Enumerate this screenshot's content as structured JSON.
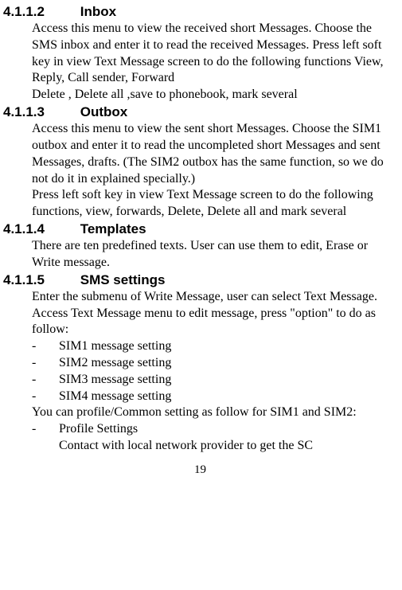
{
  "sections": {
    "inbox": {
      "num": "4.1.1.2",
      "title": "Inbox",
      "p1": "Access this menu to view the received short Messages. Choose the SMS inbox and enter it to read the received Messages. Press left soft key in view Text Message screen to do the following functions View, Reply, Call sender, Forward",
      "p2": "Delete , Delete all ,save to phonebook, mark several"
    },
    "outbox": {
      "num": "4.1.1.3",
      "title": "Outbox",
      "p1": "Access this menu to view the sent short Messages. Choose the SIM1 outbox and enter it to read the uncompleted short Messages and sent Messages, drafts. (The SIM2 outbox has the same function, so we do not do it in explained specially.)",
      "p2": "Press left soft key in view Text Message screen to do the following functions, view, forwards, Delete, Delete all and mark several"
    },
    "templates": {
      "num": "4.1.1.4",
      "title": "Templates",
      "p1": "There are ten predefined texts. User can use them to edit, Erase or Write message."
    },
    "sms": {
      "num": "4.1.1.5",
      "title": "SMS settings",
      "p1": "Enter the submenu of Write Message, user can select Text Message. Access Text Message menu to edit message, press \"option\" to do as follow:",
      "items": [
        "SIM1 message setting",
        "SIM2 message setting",
        "SIM3 message setting",
        "SIM4 message setting"
      ],
      "p2": "You can profile/Common setting as follow for SIM1 and SIM2:",
      "items2": [
        "Profile Settings"
      ],
      "sub1": "Contact with local network provider to get the SC"
    }
  },
  "dash": "-",
  "page_number": "19"
}
